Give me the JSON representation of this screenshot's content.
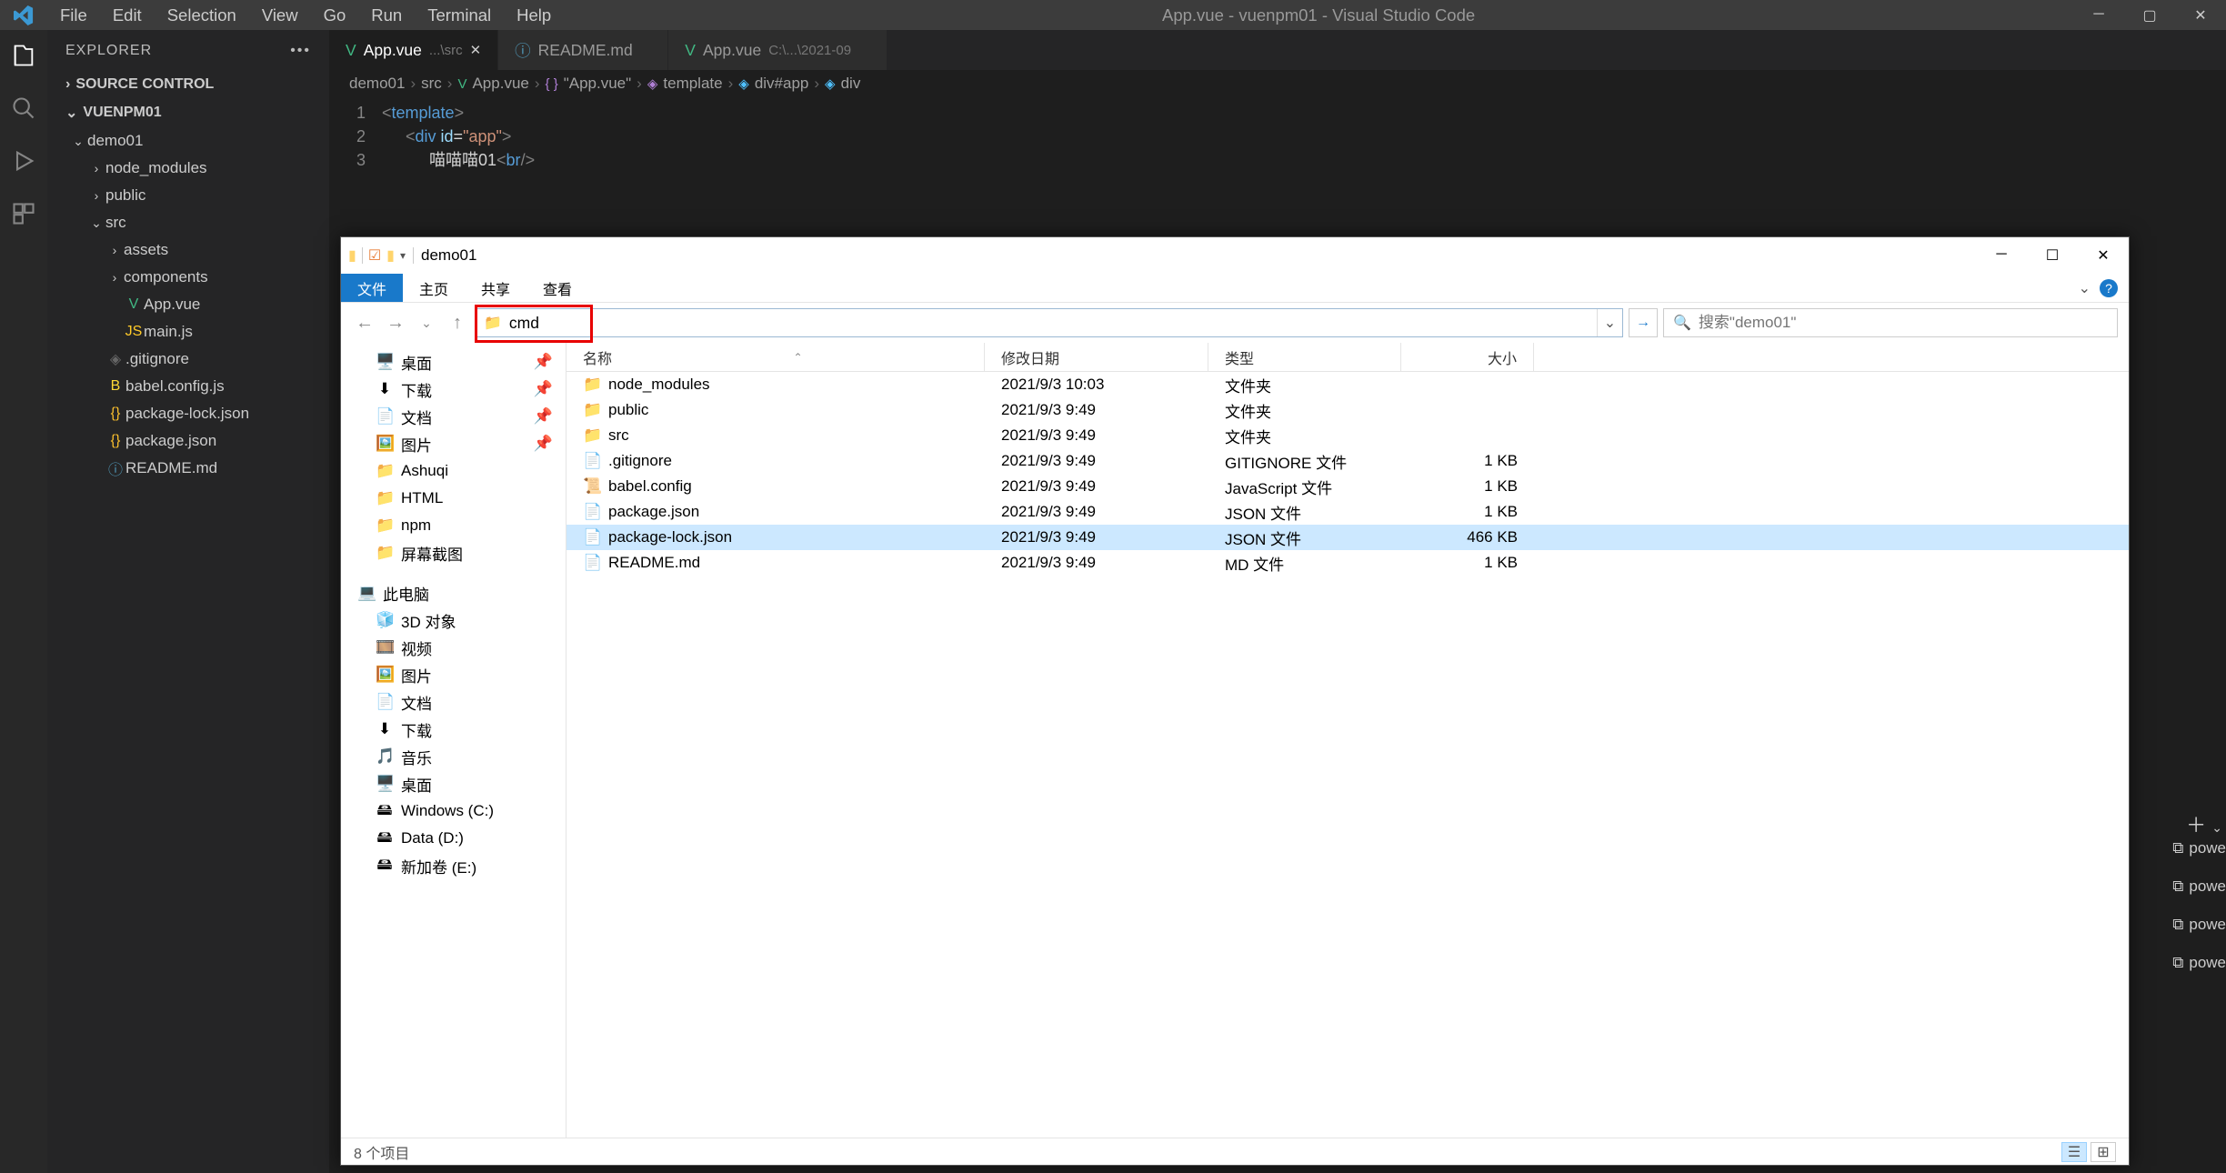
{
  "vscode": {
    "menubar": [
      "File",
      "Edit",
      "Selection",
      "View",
      "Go",
      "Run",
      "Terminal",
      "Help"
    ],
    "title": "App.vue - vuenpm01 - Visual Studio Code",
    "sidebar": {
      "header": "EXPLORER",
      "section1": "SOURCE CONTROL",
      "section2": "VUENPM01",
      "tree": {
        "root": "demo01",
        "folders": [
          "node_modules",
          "public",
          "src"
        ],
        "srcChildren": [
          "assets",
          "components"
        ],
        "srcFiles": [
          {
            "name": "App.vue",
            "type": "vue"
          },
          {
            "name": "main.js",
            "type": "js"
          }
        ],
        "rootFiles": [
          {
            "name": ".gitignore",
            "type": "git"
          },
          {
            "name": "babel.config.js",
            "type": "babel"
          },
          {
            "name": "package-lock.json",
            "type": "json"
          },
          {
            "name": "package.json",
            "type": "json"
          },
          {
            "name": "README.md",
            "type": "md"
          }
        ]
      }
    },
    "tabs": [
      {
        "label": "App.vue",
        "hint": "...\\src",
        "active": true,
        "type": "vue"
      },
      {
        "label": "README.md",
        "hint": "",
        "active": false,
        "type": "md"
      },
      {
        "label": "App.vue",
        "hint": "C:\\...\\2021-09",
        "active": false,
        "type": "vue"
      }
    ],
    "breadcrumb": [
      "demo01",
      "src",
      "App.vue",
      "\"App.vue\"",
      "template",
      "div#app",
      "div"
    ],
    "code": {
      "lines": [
        "1",
        "2",
        "3"
      ],
      "l1a": "<",
      "l1b": "template",
      "l1c": ">",
      "l2a": "<",
      "l2b": "div ",
      "l2c": "id",
      "l2d": "=",
      "l2e": "\"app\"",
      "l2f": ">",
      "l3a": "喵喵喵01",
      "l3b": "<",
      "l3c": "br",
      "l3d": "/>"
    },
    "terminals": [
      "powe",
      "powe",
      "powe",
      "powe"
    ]
  },
  "fe": {
    "title": "demo01",
    "ribbon": {
      "file": "文件",
      "home": "主页",
      "share": "共享",
      "view": "查看"
    },
    "address": "cmd",
    "searchPlaceholder": "搜索\"demo01\"",
    "tree": {
      "quick": [
        {
          "name": "桌面",
          "icon": "desktop",
          "pin": true
        },
        {
          "name": "下载",
          "icon": "download",
          "pin": true
        },
        {
          "name": "文档",
          "icon": "doc",
          "pin": true
        },
        {
          "name": "图片",
          "icon": "pic",
          "pin": true
        },
        {
          "name": "Ashuqi",
          "icon": "folder"
        },
        {
          "name": "HTML",
          "icon": "folder"
        },
        {
          "name": "npm",
          "icon": "folder"
        },
        {
          "name": "屏幕截图",
          "icon": "folder"
        }
      ],
      "thispc": {
        "label": "此电脑",
        "items": [
          {
            "name": "3D 对象",
            "icon": "3d"
          },
          {
            "name": "视频",
            "icon": "video"
          },
          {
            "name": "图片",
            "icon": "pic"
          },
          {
            "name": "文档",
            "icon": "doc"
          },
          {
            "name": "下载",
            "icon": "download"
          },
          {
            "name": "音乐",
            "icon": "music"
          },
          {
            "name": "桌面",
            "icon": "desktop"
          },
          {
            "name": "Windows (C:)",
            "icon": "drive"
          },
          {
            "name": "Data (D:)",
            "icon": "drive"
          },
          {
            "name": "新加卷 (E:)",
            "icon": "drive"
          }
        ]
      }
    },
    "columns": {
      "name": "名称",
      "date": "修改日期",
      "type": "类型",
      "size": "大小"
    },
    "items": [
      {
        "name": "node_modules",
        "date": "2021/9/3 10:03",
        "type": "文件夹",
        "size": "",
        "icon": "folder"
      },
      {
        "name": "public",
        "date": "2021/9/3 9:49",
        "type": "文件夹",
        "size": "",
        "icon": "folder"
      },
      {
        "name": "src",
        "date": "2021/9/3 9:49",
        "type": "文件夹",
        "size": "",
        "icon": "folder"
      },
      {
        "name": ".gitignore",
        "date": "2021/9/3 9:49",
        "type": "GITIGNORE 文件",
        "size": "1 KB",
        "icon": "file"
      },
      {
        "name": "babel.config",
        "date": "2021/9/3 9:49",
        "type": "JavaScript 文件",
        "size": "1 KB",
        "icon": "js"
      },
      {
        "name": "package.json",
        "date": "2021/9/3 9:49",
        "type": "JSON 文件",
        "size": "1 KB",
        "icon": "file"
      },
      {
        "name": "package-lock.json",
        "date": "2021/9/3 9:49",
        "type": "JSON 文件",
        "size": "466 KB",
        "icon": "file",
        "selected": true
      },
      {
        "name": "README.md",
        "date": "2021/9/3 9:49",
        "type": "MD 文件",
        "size": "1 KB",
        "icon": "file"
      }
    ],
    "status": "8 个项目"
  }
}
